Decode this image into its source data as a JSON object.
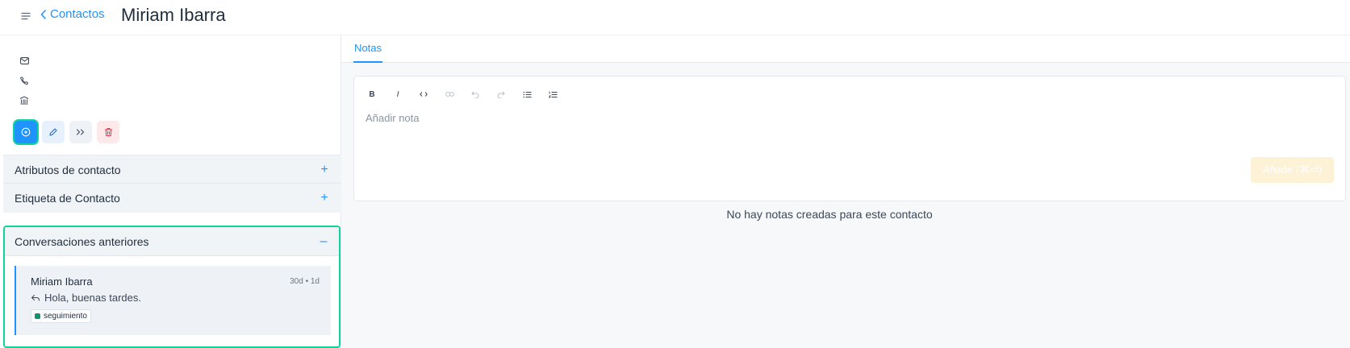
{
  "header": {
    "back_label": "Contactos",
    "title": "Miriam Ibarra"
  },
  "contact": {
    "icons": [
      "mail-icon",
      "phone-icon",
      "company-icon"
    ],
    "actions": [
      "new-message",
      "edit",
      "merge",
      "delete"
    ]
  },
  "sections": {
    "attributes": {
      "label": "Atributos de contacto",
      "icon": "+"
    },
    "labels": {
      "label": "Etiqueta de Contacto",
      "icon": "+"
    },
    "previous": {
      "label": "Conversaciones anteriores",
      "icon": "–"
    }
  },
  "conversation": {
    "name": "Miriam Ibarra",
    "time": "30d • 1d",
    "message": "Hola, buenas tardes.",
    "tag": "seguimiento",
    "tag_color": "#13926f"
  },
  "notes": {
    "tab_label": "Notas",
    "placeholder": "Añadir nota",
    "add_label": "Añade (⌘⏎)",
    "empty_text": "No hay notas creadas para este contacto"
  },
  "colors": {
    "accent": "#1f93ff",
    "highlight": "#10d39b"
  }
}
